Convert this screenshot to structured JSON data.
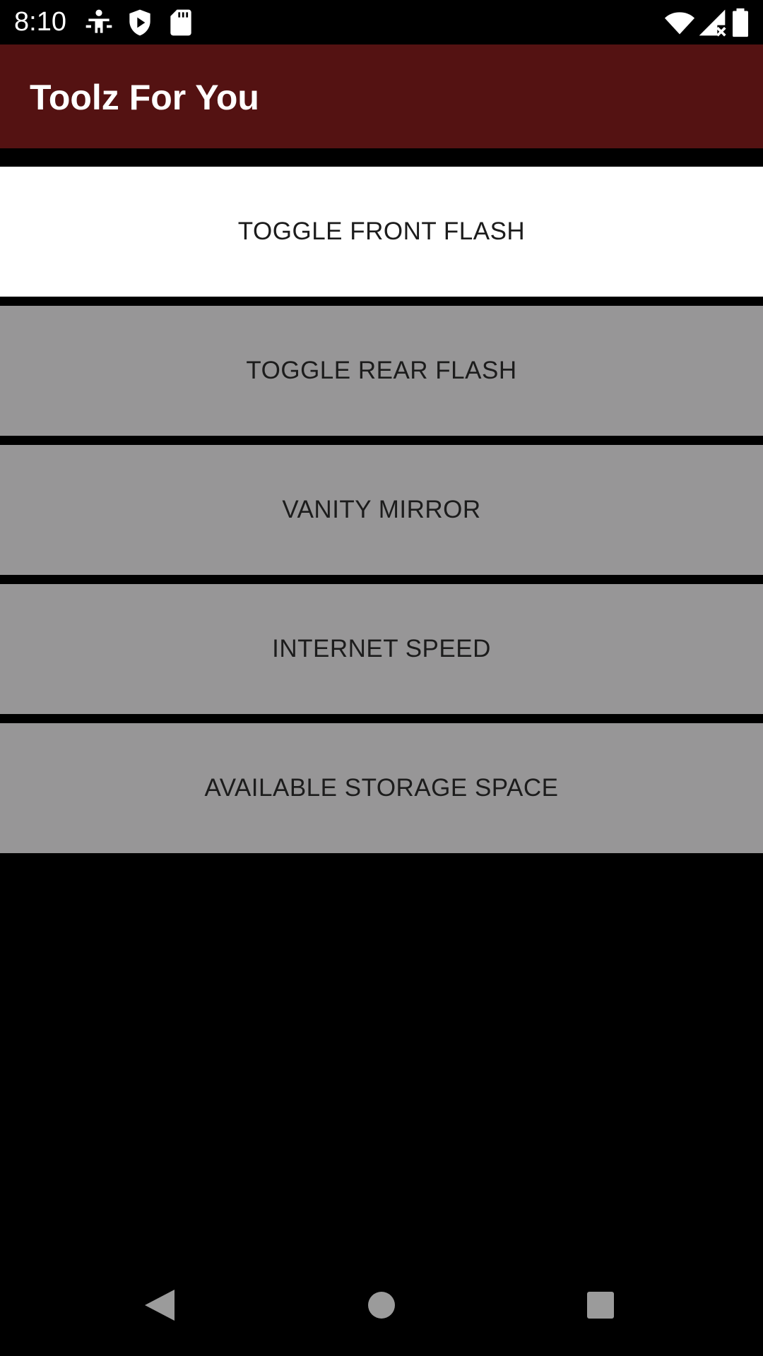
{
  "status_bar": {
    "time": "8:10",
    "left_icons": [
      "accessibility-icon",
      "shield-icon",
      "sd-card-icon"
    ],
    "right_icons": [
      "wifi-icon",
      "signal-no-data-icon",
      "battery-icon"
    ]
  },
  "app_bar": {
    "title": "Toolz For You",
    "color": "#541212"
  },
  "tools": [
    {
      "label": "TOGGLE FRONT FLASH",
      "state": "active"
    },
    {
      "label": "TOGGLE REAR FLASH",
      "state": "default"
    },
    {
      "label": "VANITY MIRROR",
      "state": "default"
    },
    {
      "label": "INTERNET SPEED",
      "state": "default"
    },
    {
      "label": "AVAILABLE STORAGE SPACE",
      "state": "default"
    }
  ],
  "colors": {
    "button_default": "#979697",
    "button_active": "#ffffff",
    "background": "#000000"
  },
  "nav_bar": {
    "icons": [
      "back-icon",
      "home-icon",
      "recents-icon"
    ]
  }
}
